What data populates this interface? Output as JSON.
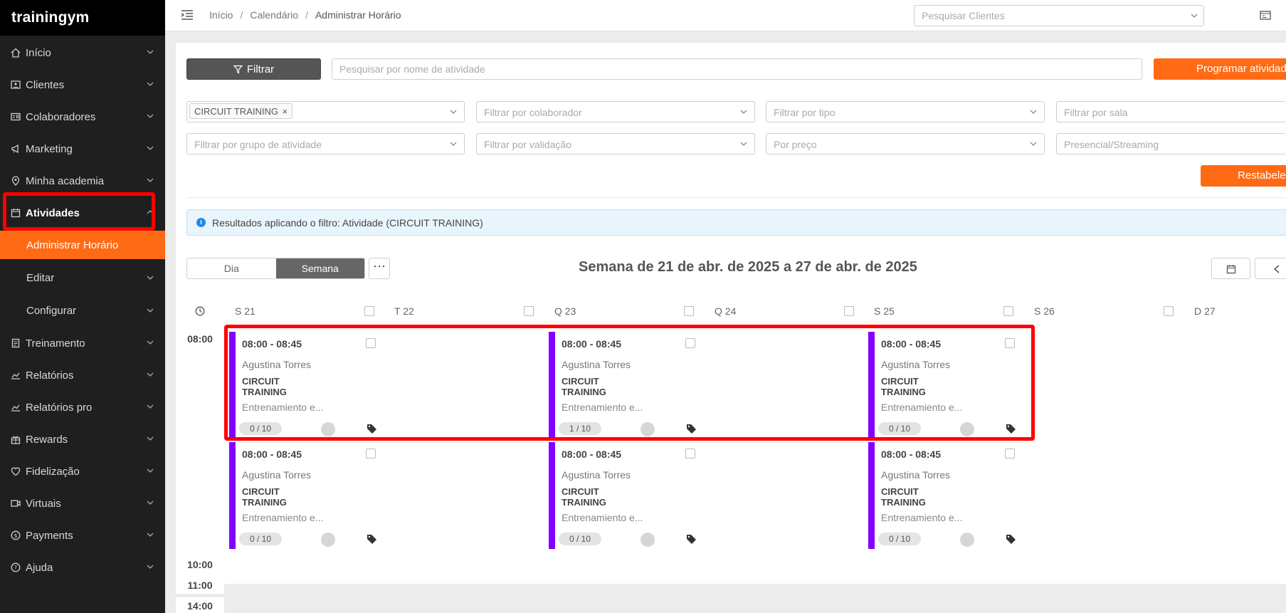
{
  "app": {
    "logo_text": "trainingym"
  },
  "sidebar": {
    "items": [
      {
        "label": "Início",
        "icon": "home-icon"
      },
      {
        "label": "Clientes",
        "icon": "id-card-icon"
      },
      {
        "label": "Colaboradores",
        "icon": "badge-icon"
      },
      {
        "label": "Marketing",
        "icon": "megaphone-icon"
      },
      {
        "label": "Minha academia",
        "icon": "location-pin-icon"
      },
      {
        "label": "Atividades",
        "icon": "calendar-icon"
      },
      {
        "label": "Treinamento",
        "icon": "clipboard-icon"
      },
      {
        "label": "Relatórios",
        "icon": "chart-line-icon"
      },
      {
        "label": "Relatórios pro",
        "icon": "chart-line-icon"
      },
      {
        "label": "Rewards",
        "icon": "gift-icon"
      },
      {
        "label": "Fidelização",
        "icon": "heart-icon"
      },
      {
        "label": "Virtuais",
        "icon": "video-icon"
      },
      {
        "label": "Payments",
        "icon": "dollar-icon"
      },
      {
        "label": "Ajuda",
        "icon": "question-icon"
      }
    ],
    "sub_items": [
      {
        "label": "Administrar Horário"
      },
      {
        "label": "Editar"
      },
      {
        "label": "Configurar"
      }
    ]
  },
  "topbar": {
    "breadcrumb": [
      "Início",
      "Calendário",
      "Administrar Horário"
    ],
    "client_search_placeholder": "Pesquisar Clientes"
  },
  "filters": {
    "filter_button": "Filtrar",
    "activity_search_placeholder": "Pesquisar por nome de atividade",
    "program_button": "Programar atividade",
    "activity_chip": "CIRCUIT TRAINING",
    "collaborator": "Filtrar por colaborador",
    "type": "Filtrar por tipo",
    "room": "Filtrar por sala",
    "group": "Filtrar por grupo de atividade",
    "validation": "Filtrar por validação",
    "price": "Por preço",
    "mode": "Presencial/Streaming",
    "reset_button": "Restabelecer"
  },
  "info_message": "Resultados aplicando o filtro: Atividade (CIRCUIT TRAINING)",
  "view": {
    "day": "Dia",
    "week": "Semana",
    "more": "⋯"
  },
  "week_title": "Semana de 21 de abr. de 2025 a 27 de abr. de 2025",
  "days": [
    "S 21",
    "T 22",
    "Q 23",
    "Q 24",
    "S 25",
    "S 26",
    "D 27"
  ],
  "times": [
    "08:00",
    "10:00",
    "11:00",
    "14:00"
  ],
  "events": [
    {
      "time": "08:00 - 08:45",
      "coach": "Agustina Torres",
      "name": "CIRCUIT TRAINING",
      "desc": "Entrenamiento e...",
      "capacity": "0 / 10"
    },
    {
      "time": "08:00 - 08:45",
      "coach": "Agustina Torres",
      "name": "CIRCUIT TRAINING",
      "desc": "Entrenamiento e...",
      "capacity": "1 / 10"
    },
    {
      "time": "08:00 - 08:45",
      "coach": "Agustina Torres",
      "name": "CIRCUIT TRAINING",
      "desc": "Entrenamiento e...",
      "capacity": "0 / 10"
    },
    {
      "time": "08:00 - 08:45",
      "coach": "Agustina Torres",
      "name": "CIRCUIT TRAINING",
      "desc": "Entrenamiento e...",
      "capacity": "0 / 10"
    },
    {
      "time": "08:00 - 08:45",
      "coach": "Agustina Torres",
      "name": "CIRCUIT TRAINING",
      "desc": "Entrenamiento e...",
      "capacity": "0 / 10"
    },
    {
      "time": "08:00 - 08:45",
      "coach": "Agustina Torres",
      "name": "CIRCUIT TRAINING",
      "desc": "Entrenamiento e...",
      "capacity": "0 / 10"
    }
  ],
  "colors": {
    "accent": "#ff6a14",
    "event_bar": "#8300ff",
    "highlight": "#ff0000"
  }
}
